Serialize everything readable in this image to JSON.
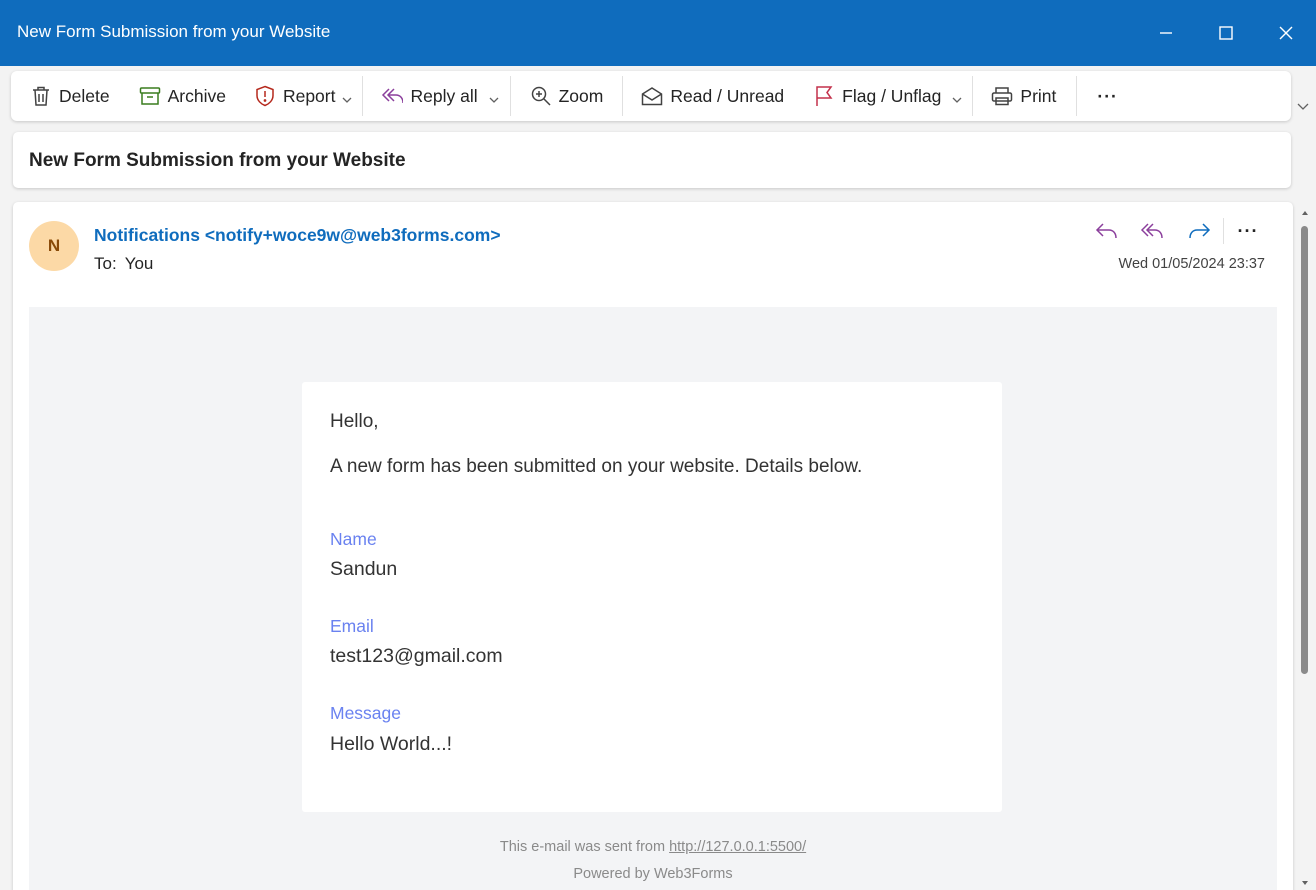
{
  "window": {
    "title": "New Form Submission from your Website"
  },
  "toolbar": {
    "delete_label": "Delete",
    "archive_label": "Archive",
    "report_label": "Report",
    "reply_all_label": "Reply all",
    "zoom_label": "Zoom",
    "read_unread_label": "Read / Unread",
    "flag_label": "Flag / Unflag",
    "print_label": "Print",
    "more_label": "···"
  },
  "message": {
    "subject": "New Form Submission from your Website",
    "avatar_initial": "N",
    "sender": "Notifications <notify+woce9w@web3forms.com>",
    "to_label": "To:",
    "to_value": "You",
    "date": "Wed 01/05/2024 23:37",
    "more_label": "···"
  },
  "email": {
    "greeting": "Hello,",
    "intro": "A new form has been submitted on your website. Details below.",
    "fields": [
      {
        "label": "Name",
        "value": "Sandun"
      },
      {
        "label": "Email",
        "value": "test123@gmail.com"
      },
      {
        "label": "Message",
        "value": "Hello World...!"
      }
    ],
    "footer_prefix": "This e-mail was sent from ",
    "footer_link": "http://127.0.0.1:5500/",
    "powered_by": "Powered by Web3Forms"
  },
  "colors": {
    "titlebar": "#0f6cbd",
    "sender_link": "#0f6cbd",
    "field_label": "#6a82f0",
    "avatar_bg": "#fcd9a6",
    "reply_icon": "#8b3f9c",
    "forward_icon": "#0f6cbd",
    "archive_icon": "#3a7d1f",
    "report_icon": "#b5281c",
    "flag_icon": "#c4314b"
  },
  "icons": {
    "delete": "trash-icon",
    "archive": "archive-box-icon",
    "report": "shield-alert-icon",
    "reply_all": "reply-all-icon",
    "zoom": "zoom-in-icon",
    "read_unread": "envelope-open-icon",
    "flag": "flag-icon",
    "print": "printer-icon"
  }
}
